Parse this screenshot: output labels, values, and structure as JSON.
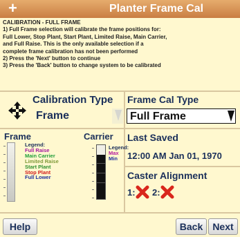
{
  "titlebar": {
    "icon": "plus-icon",
    "title": "Planter Frame Cal"
  },
  "instructions": {
    "text": "CALIBRATION - FULL FRAME\n1) Full Frame selection will calibrate the frame positions for:\nFull Lower, Stop Plant, Start Plant, Limited Raise, Main Carrier,\nand Full Raise.  This is the only available selection if a\ncomplete frame calibration has not been performed\n2) Press the 'Next' button to continue\n3) Press the 'Back' button to change system to be calibrated"
  },
  "calibration_type": {
    "label": "Calibration Type",
    "value": "Frame",
    "icon": "move-arrows-icon"
  },
  "frame_cal_type": {
    "label": "Frame Cal Type",
    "value": "Full Frame"
  },
  "frame": {
    "label": "Frame",
    "legend_title": "Legend:",
    "legend": [
      {
        "label": "Full Raise",
        "color": "#a0179f"
      },
      {
        "label": "Main Carrier",
        "color": "#1f9e3a"
      },
      {
        "label": "Limited Raise",
        "color": "#7e9a3a"
      },
      {
        "label": "Start Plant",
        "color": "#2e8f2e"
      },
      {
        "label": "Stop Plant",
        "color": "#d11b1b"
      },
      {
        "label": "Full Lower",
        "color": "#1d2f9c"
      }
    ]
  },
  "carrier": {
    "label": "Carrier",
    "legend_title": "Legend:",
    "legend": [
      {
        "label": "Max",
        "color": "#b3189e"
      },
      {
        "label": "Min",
        "color": "#1d2f9c"
      }
    ]
  },
  "last_saved": {
    "label": "Last Saved",
    "value": "12:00 AM Jan 01, 1970"
  },
  "caster_alignment": {
    "label": "Caster Alignment",
    "items": [
      {
        "num": "1:",
        "status_icon": "red-x-icon"
      },
      {
        "num": "2:",
        "status_icon": "red-x-icon"
      }
    ]
  },
  "buttons": {
    "help": "Help",
    "back": "Back",
    "next": "Next"
  },
  "colors": {
    "background": "#fff8cf",
    "title_bar": "#d48a4e",
    "label_text": "#1a2f5a",
    "error_x": "#d9271c"
  }
}
